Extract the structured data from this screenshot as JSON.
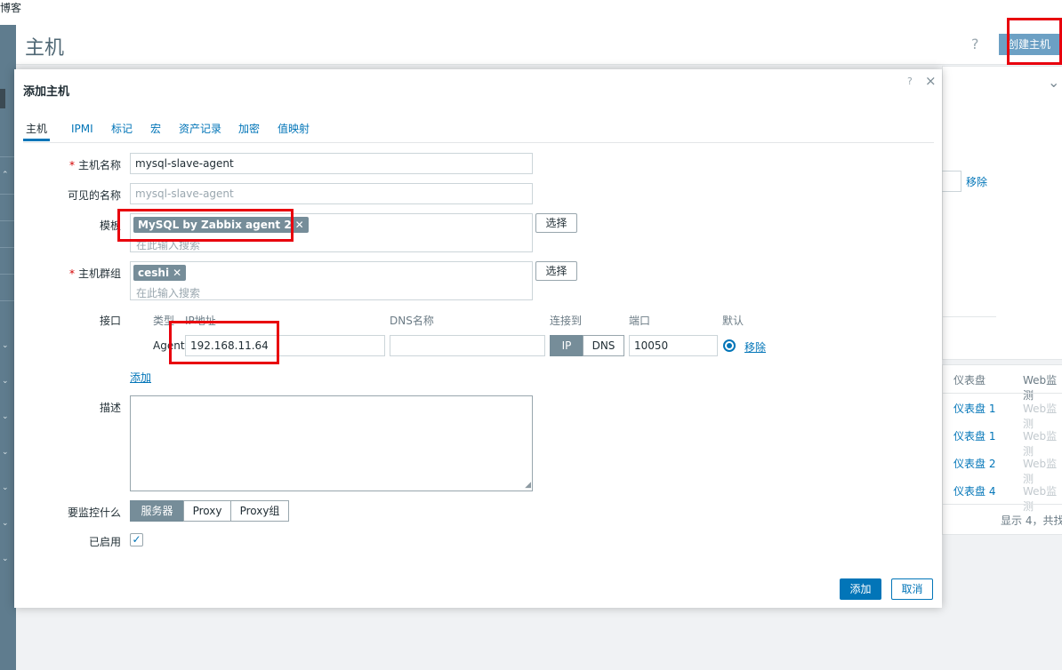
{
  "topbar": {
    "text": "博客"
  },
  "page": {
    "title": "主机",
    "help_icon": "?",
    "create_host_label": "创建主机"
  },
  "background": {
    "remove_label": "移除",
    "table_headers": [
      "仪表盘",
      "Web监测"
    ],
    "dashboards": [
      "仪表盘 1",
      "仪表盘 1",
      "仪表盘 2",
      "仪表盘 4"
    ],
    "web_cells": [
      "Web监测",
      "Web监测",
      "Web监测",
      "Web监测"
    ],
    "footer": "显示 4，共找"
  },
  "dialog": {
    "title": "添加主机",
    "help": "?",
    "close": "×",
    "tabs": [
      "主机",
      "IPMI",
      "标记",
      "宏",
      "资产记录",
      "加密",
      "值映射"
    ],
    "fields": {
      "host_name_label": "主机名称",
      "host_name_value": "mysql-slave-agent",
      "visible_name_label": "可见的名称",
      "visible_name_placeholder": "mysql-slave-agent",
      "templates_label": "模板",
      "template_chip": "MySQL by Zabbix agent 2",
      "templates_placeholder": "在此输入搜索",
      "select_label": "选择",
      "host_groups_label": "主机群组",
      "group_chip": "ceshi",
      "groups_placeholder": "在此输入搜索",
      "interfaces_label": "接口",
      "description_label": "描述",
      "monitored_by_label": "要监控什么",
      "enabled_label": "已启用"
    },
    "interfaces": {
      "headers": {
        "type": "类型",
        "ip": "IP地址",
        "dns": "DNS名称",
        "connect_to": "连接到",
        "port": "端口",
        "default": "默认"
      },
      "row": {
        "type": "Agent",
        "ip": "192.168.11.64",
        "dns": "",
        "connect_ip": "IP",
        "connect_dns": "DNS",
        "port": "10050",
        "remove": "移除"
      },
      "add_label": "添加"
    },
    "monitored_by": {
      "options": [
        "服务器",
        "Proxy",
        "Proxy组"
      ],
      "selected": "服务器"
    },
    "enabled": true,
    "buttons": {
      "add": "添加",
      "cancel": "取消"
    }
  },
  "colors": {
    "accent": "#0275b8",
    "highlight": "#e8000d",
    "nav": "#5f7c8e"
  }
}
